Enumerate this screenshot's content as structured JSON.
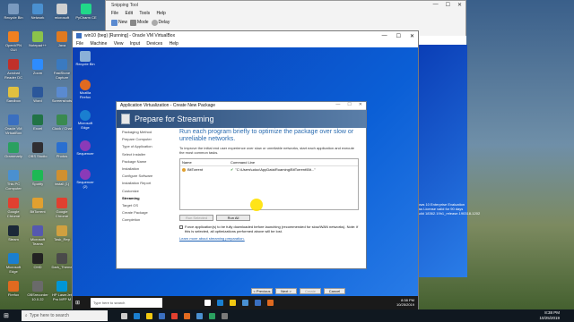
{
  "host_desktop": {
    "icons": [
      {
        "label": "Recycle Bin",
        "color": "#7a9abf"
      },
      {
        "label": "OpenVPN GUI",
        "color": "#f08020"
      },
      {
        "label": "Acrobat Reader DC",
        "color": "#c0302a"
      },
      {
        "label": "Sandbox",
        "color": "#e0c040"
      },
      {
        "label": "Oracle VM VirtualBox",
        "color": "#3a6fc0"
      },
      {
        "label": "Grammarly",
        "color": "#2aa060"
      },
      {
        "label": "This PC Computer",
        "color": "#4a90d0"
      },
      {
        "label": "Google Chrome",
        "color": "#e04030"
      },
      {
        "label": "Steam",
        "color": "#1b2838"
      },
      {
        "label": "Microsoft Edge",
        "color": "#1a7fd0"
      },
      {
        "label": "Firefox",
        "color": "#e06a20"
      },
      {
        "label": "Network",
        "color": "#4a90d0"
      },
      {
        "label": "Notepad++",
        "color": "#8bc34a"
      },
      {
        "label": "Zoom",
        "color": "#2d8cff"
      },
      {
        "label": "Word",
        "color": "#2b579a"
      },
      {
        "label": "Excel",
        "color": "#217346"
      },
      {
        "label": "OBS Studio",
        "color": "#302e31"
      },
      {
        "label": "Spotify",
        "color": "#1db954"
      },
      {
        "label": "BitTorrent",
        "color": "#e0a030"
      },
      {
        "label": "Microsoft Teams",
        "color": "#5558af"
      },
      {
        "label": "CMD",
        "color": "#222222"
      },
      {
        "label": "OBSrecorder 10.0.22",
        "color": "#6a6a6a"
      },
      {
        "label": "microsoft",
        "color": "#d0d0d0"
      },
      {
        "label": "Java",
        "color": "#e07a20"
      },
      {
        "label": "FastStone Capture",
        "color": "#3a7ac0"
      },
      {
        "label": "Screenshots",
        "color": "#5a8ad0"
      },
      {
        "label": "Clock / Chat",
        "color": "#3a8a50"
      },
      {
        "label": "Photos",
        "color": "#2a6fd0"
      },
      {
        "label": "install (1)",
        "color": "#d09030"
      },
      {
        "label": "Google Chrome",
        "color": "#e04030"
      },
      {
        "label": "Task_Rep",
        "color": "#d0a040"
      },
      {
        "label": "Dark_Theme",
        "color": "#4a4a4a"
      },
      {
        "label": "HP LaserJet Pro MFP M",
        "color": "#0096d6"
      },
      {
        "label": "PyCharm CE",
        "color": "#21d789"
      },
      {
        "label": "Kinect",
        "color": "#444444"
      }
    ]
  },
  "snipping_tool": {
    "title": "Snipping Tool",
    "menu": [
      "File",
      "Edit",
      "Tools",
      "Help"
    ],
    "toolbar": {
      "new": "New",
      "mode": "Mode",
      "delay": "Delay"
    }
  },
  "evaluation_text": [
    "dows 10 Enterprise Evaluation",
    "ows License valid for 90 days",
    "Build 18362.19h1_release.190318-1202"
  ],
  "vbox": {
    "title": "win10 (beg) [Running] - Oracle VM VirtualBox",
    "menu": [
      "File",
      "Machine",
      "View",
      "Input",
      "Devices",
      "Help"
    ]
  },
  "guest_icons": [
    "Recycle Bin",
    "Mozilla Firefox",
    "Microsoft Edge",
    "Sequencer",
    "Sequencer (2)"
  ],
  "dialog": {
    "title": "Application Virtualization - Create New Package",
    "banner": "Prepare for Streaming",
    "steps": [
      "Packaging Method",
      "Prepare Computer",
      "Type of Application",
      "Select Installer",
      "Package Name",
      "Installation",
      "Configure Software",
      "Installation Report",
      "Customize",
      "Streaming",
      "Target OS",
      "Create Package",
      "Completion"
    ],
    "current_step": "Streaming",
    "heading": "Run each program briefly to optimize the package over slow or unreliable networks.",
    "description": "To improve the initial end user experience over slow or unreliable networks, start each application and execute the most common tasks.",
    "table": {
      "headers": [
        "Name",
        "Command Line"
      ],
      "rows": [
        {
          "name": "BitTorrent",
          "command": "\"C:\\Users\\udoc\\AppData\\Roaming\\BitTorrent\\Bit...\""
        }
      ]
    },
    "buttons": {
      "run_selected": "Run Selected",
      "run_all": "Run All",
      "previous": "< Previous",
      "next": "Next >",
      "create": "Create",
      "cancel": "Cancel"
    },
    "checkbox_label": "Force application(s) to be fully downloaded before launching (recommended for slow/WAN networks). Note: if this is selected, all optimizations performed above will be lost.",
    "link": "Learn more about streaming preparation."
  },
  "guest_taskbar": {
    "search_placeholder": "Type here to search",
    "time": "8:38 PM",
    "date": "10/25/2019",
    "apps": [
      "#ffffff",
      "#1a7fd0",
      "#f2c811",
      "#4a90d0",
      "#3a6fc0",
      "#e06a20"
    ]
  },
  "host_taskbar": {
    "search_placeholder": "Type here to search",
    "time": "8:38 PM",
    "date": "10/25/2019",
    "apps": [
      "#cccccc",
      "#1a7fd0",
      "#f2c811",
      "#3a6fc0",
      "#e04030",
      "#e06a20",
      "#4a90d0",
      "#2aa060",
      "#7a7a7a"
    ]
  }
}
